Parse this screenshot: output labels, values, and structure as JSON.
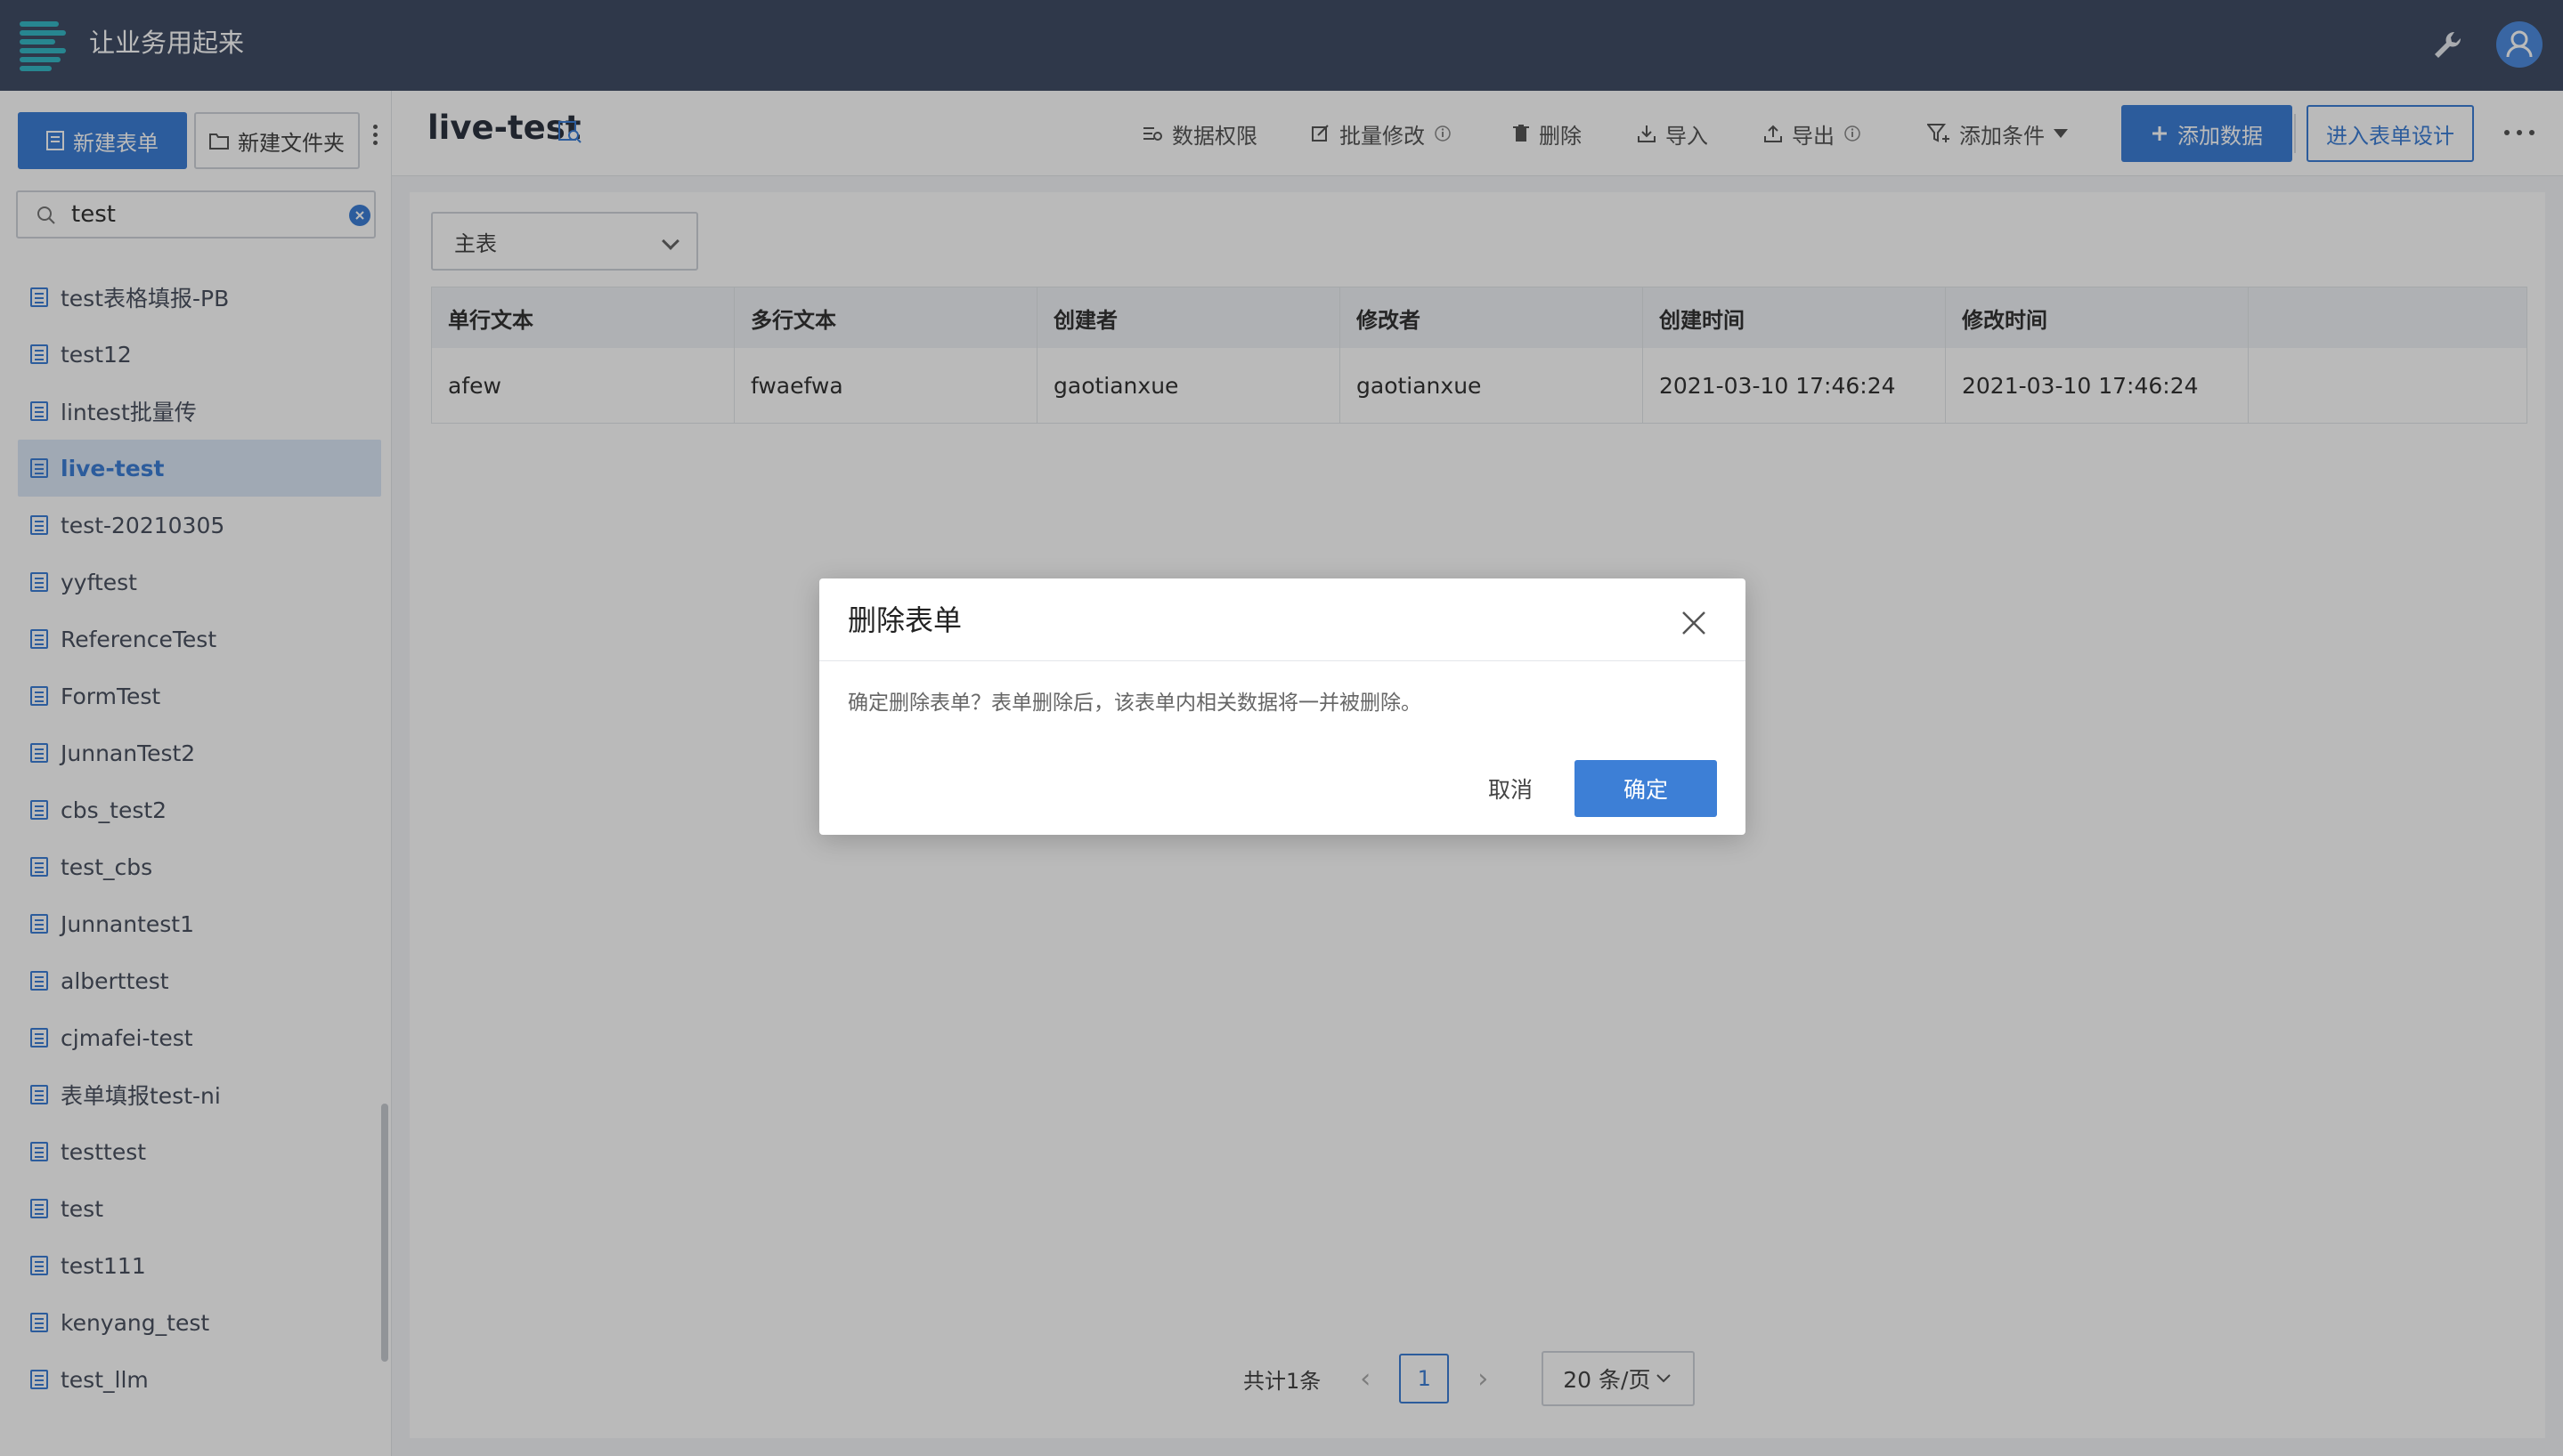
{
  "app": {
    "title": "让业务用起来",
    "accent": "#3d7fd6",
    "topbar_color": "#414e66"
  },
  "topbar": {
    "tools_icon": "wrench-icon",
    "user_icon": "user-avatar-icon"
  },
  "sidebar": {
    "new_form_label": "新建表单",
    "new_folder_label": "新建文件夹",
    "search": {
      "value": "test",
      "placeholder": ""
    },
    "items": [
      {
        "label": "test表格填报-PB",
        "active": false
      },
      {
        "label": "test12",
        "active": false
      },
      {
        "label": "lintest批量传",
        "active": false
      },
      {
        "label": "live-test",
        "active": true
      },
      {
        "label": "test-20210305",
        "active": false
      },
      {
        "label": "yyftest",
        "active": false
      },
      {
        "label": "ReferenceTest",
        "active": false
      },
      {
        "label": "FormTest",
        "active": false
      },
      {
        "label": "JunnanTest2",
        "active": false
      },
      {
        "label": "cbs_test2",
        "active": false
      },
      {
        "label": "test_cbs",
        "active": false
      },
      {
        "label": "Junnantest1",
        "active": false
      },
      {
        "label": "alberttest",
        "active": false
      },
      {
        "label": "cjmafei-test",
        "active": false
      },
      {
        "label": "表单填报test-ni",
        "active": false
      },
      {
        "label": "testtest",
        "active": false
      },
      {
        "label": "test",
        "active": false
      },
      {
        "label": "test111",
        "active": false
      },
      {
        "label": "kenyang_test",
        "active": false
      },
      {
        "label": "test_llm",
        "active": false
      }
    ]
  },
  "header": {
    "title": "live-test",
    "toolbar": {
      "permissions": "数据权限",
      "batch_edit": "批量修改",
      "delete": "删除",
      "import": "导入",
      "export": "导出",
      "add_condition": "添加条件",
      "add_data": "添加数据",
      "enter_design": "进入表单设计"
    }
  },
  "table": {
    "selector": "主表",
    "columns": [
      "单行文本",
      "多行文本",
      "创建者",
      "修改者",
      "创建时间",
      "修改时间"
    ],
    "rows": [
      [
        "afew",
        "fwaefwa",
        "gaotianxue",
        "gaotianxue",
        "2021-03-10 17:46:24",
        "2021-03-10 17:46:24"
      ]
    ]
  },
  "pagination": {
    "total": "共计1条",
    "current_page": "1",
    "page_size": "20 条/页"
  },
  "dialog": {
    "title": "删除表单",
    "message": "确定删除表单？表单删除后，该表单内相关数据将一并被删除。",
    "cancel": "取消",
    "confirm": "确定"
  }
}
